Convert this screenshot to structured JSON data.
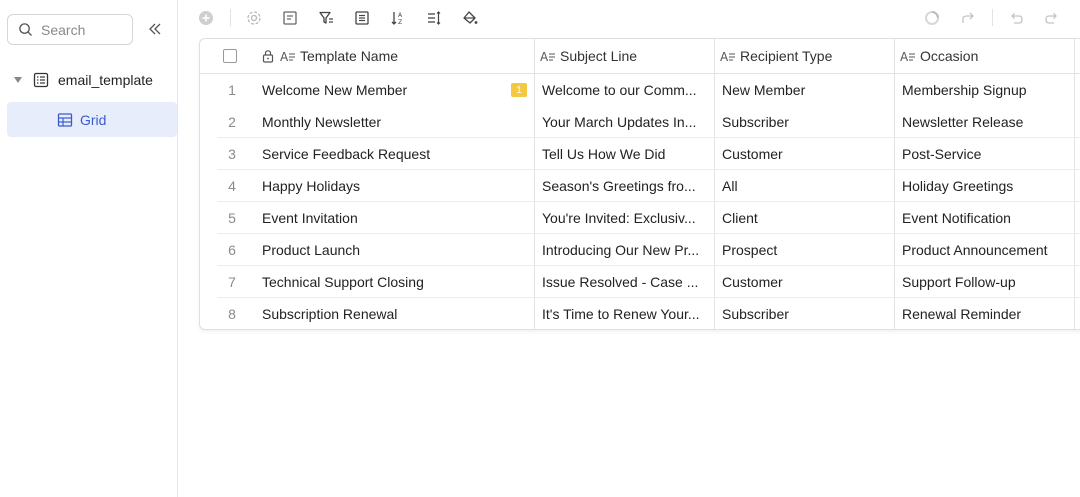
{
  "sidebar": {
    "search_placeholder": "Search",
    "base_name": "email_template",
    "view_name": "Grid"
  },
  "toolbar": {
    "icons": [
      "add-icon",
      "settings-icon",
      "form-icon",
      "filter-icon",
      "list-icon",
      "sort-az-icon",
      "row-height-icon",
      "fill-color-icon",
      "loading-icon",
      "redo-arrow-icon",
      "undo-icon",
      "redo-icon"
    ]
  },
  "grid": {
    "columns": [
      {
        "name": "Template Name"
      },
      {
        "name": "Subject Line"
      },
      {
        "name": "Recipient Type"
      },
      {
        "name": "Occasion"
      }
    ],
    "rows": [
      {
        "num": "1",
        "template": "Welcome New Member",
        "subject": "Welcome to our Comm...",
        "recipient": "New Member",
        "occasion": "Membership Signup",
        "badge": "1"
      },
      {
        "num": "2",
        "template": "Monthly Newsletter",
        "subject": "Your March Updates In...",
        "recipient": "Subscriber",
        "occasion": "Newsletter Release"
      },
      {
        "num": "3",
        "template": "Service Feedback Request",
        "subject": "Tell Us How We Did",
        "recipient": "Customer",
        "occasion": "Post-Service"
      },
      {
        "num": "4",
        "template": "Happy Holidays",
        "subject": "Season's Greetings fro...",
        "recipient": "All",
        "occasion": "Holiday Greetings"
      },
      {
        "num": "5",
        "template": "Event Invitation",
        "subject": "You're Invited: Exclusiv...",
        "recipient": "Client",
        "occasion": "Event Notification"
      },
      {
        "num": "6",
        "template": "Product Launch",
        "subject": "Introducing Our New Pr...",
        "recipient": "Prospect",
        "occasion": "Product Announcement"
      },
      {
        "num": "7",
        "template": "Technical Support Closing",
        "subject": "Issue Resolved - Case ...",
        "recipient": "Customer",
        "occasion": "Support Follow-up"
      },
      {
        "num": "8",
        "template": "Subscription Renewal",
        "subject": "It's Time to Renew Your...",
        "recipient": "Subscriber",
        "occasion": "Renewal Reminder"
      }
    ]
  },
  "colors": {
    "accent": "#3b5ccf",
    "selected_bg": "#e7edfa",
    "badge": "#f5c842"
  }
}
